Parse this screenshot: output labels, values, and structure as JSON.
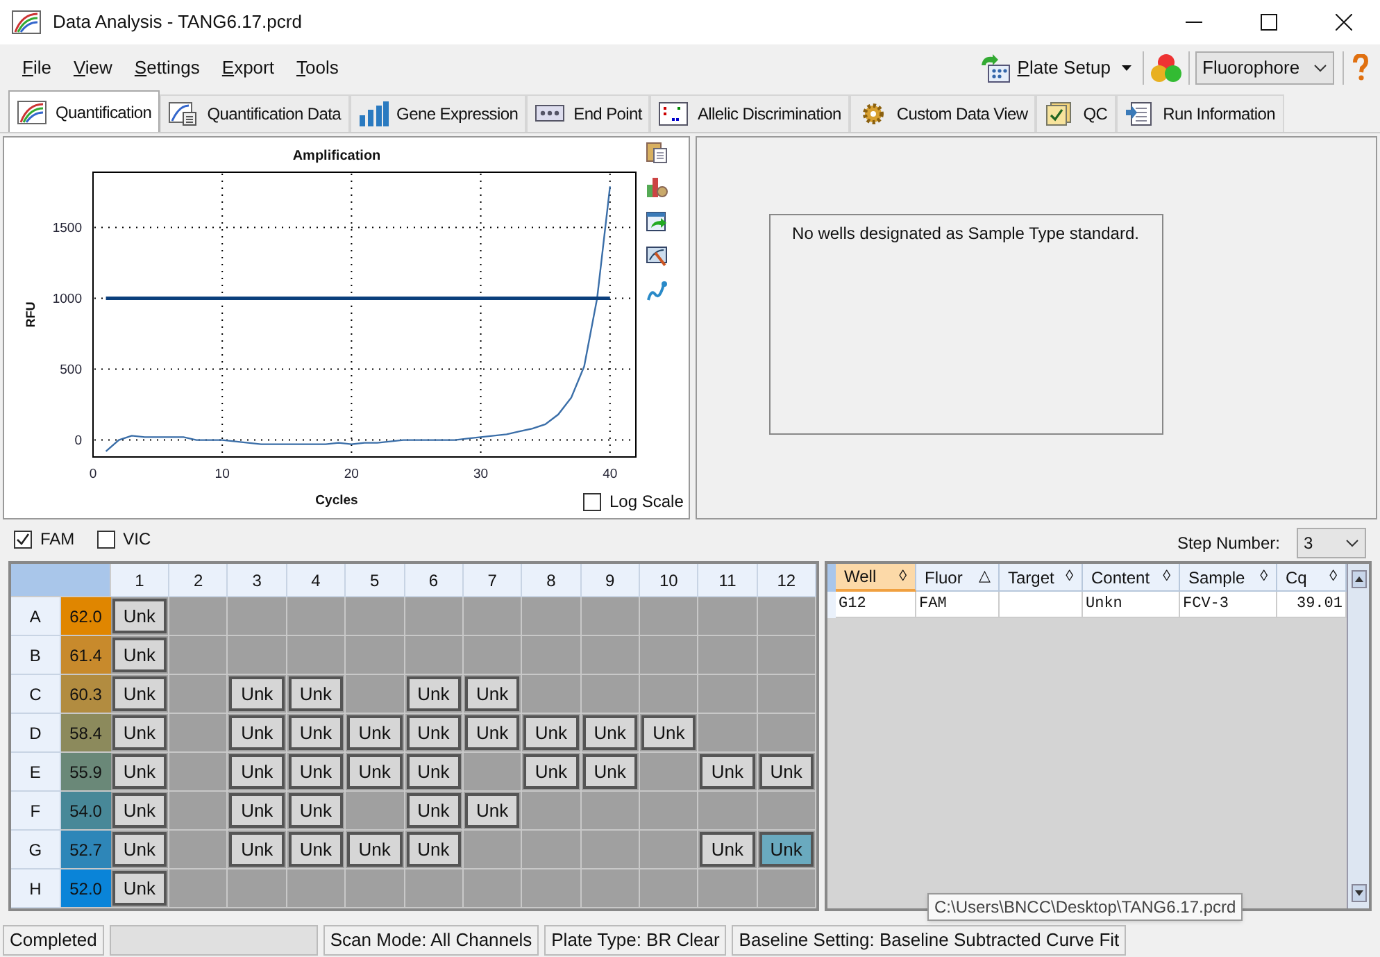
{
  "window": {
    "title": "Data Analysis - TANG6.17.pcrd"
  },
  "menu": [
    "File",
    "View",
    "Settings",
    "Export",
    "Tools"
  ],
  "toolbar": {
    "plate_setup": "Plate Setup",
    "fluorophore": "Fluorophore"
  },
  "tabs": [
    {
      "label": "Quantification",
      "selected": true
    },
    {
      "label": "Quantification Data",
      "selected": false
    },
    {
      "label": "Gene Expression",
      "selected": false
    },
    {
      "label": "End Point",
      "selected": false
    },
    {
      "label": "Allelic Discrimination",
      "selected": false
    },
    {
      "label": "Custom Data View",
      "selected": false
    },
    {
      "label": "QC",
      "selected": false
    },
    {
      "label": "Run Information",
      "selected": false
    }
  ],
  "chart": {
    "chart_data": {
      "type": "line",
      "title": "Amplification",
      "xlabel": "Cycles",
      "ylabel": "RFU",
      "xlim": [
        0,
        42
      ],
      "ylim": [
        -120,
        1890
      ],
      "xticks": [
        0,
        10,
        20,
        30,
        40
      ],
      "yticks": [
        0,
        500,
        1000,
        1500
      ],
      "x": [
        1,
        2,
        3,
        4,
        5,
        6,
        7,
        8,
        9,
        10,
        11,
        12,
        13,
        14,
        15,
        16,
        17,
        18,
        19,
        20,
        21,
        22,
        23,
        24,
        25,
        26,
        27,
        28,
        29,
        30,
        31,
        32,
        33,
        34,
        35,
        36,
        37,
        38,
        39,
        40
      ],
      "grid": true,
      "series": [
        {
          "color": "#3a6ea8",
          "values": [
            -80,
            0,
            30,
            20,
            20,
            20,
            20,
            0,
            0,
            0,
            -10,
            -20,
            -30,
            -30,
            -30,
            -30,
            -30,
            -30,
            -20,
            -30,
            -20,
            -20,
            -10,
            0,
            0,
            0,
            0,
            0,
            10,
            20,
            30,
            40,
            60,
            80,
            110,
            180,
            300,
            520,
            1000,
            1790
          ]
        },
        {
          "color": "#0b3f7c",
          "values": [
            1000,
            1000,
            1000,
            1000,
            1000,
            1000,
            1000,
            1000,
            1000,
            1000,
            1000,
            1000,
            1000,
            1000,
            1000,
            1000,
            1000,
            1000,
            1000,
            1000,
            1000,
            1000,
            1000,
            1000,
            1000,
            1000,
            1000,
            1000,
            1000,
            1000,
            1000,
            1000,
            1000,
            1000,
            1000,
            1000,
            1000,
            1000,
            1000,
            1000
          ]
        }
      ]
    }
  },
  "log_scale": {
    "label": "Log Scale",
    "checked": false
  },
  "standard_curve": {
    "message": "No wells designated as Sample Type standard."
  },
  "fluors": [
    {
      "label": "FAM",
      "checked": true
    },
    {
      "label": "VIC",
      "checked": false
    }
  ],
  "step_number": {
    "label": "Step Number:",
    "value": "3"
  },
  "plate": {
    "columns": [
      "1",
      "2",
      "3",
      "4",
      "5",
      "6",
      "7",
      "8",
      "9",
      "10",
      "11",
      "12"
    ],
    "rows": [
      {
        "label": "A",
        "temperature": "62.0",
        "color": "#e08600",
        "wells": [
          {
            "kind": "sample",
            "content": "Unk",
            "selected": false
          },
          {
            "kind": "empty"
          },
          {
            "kind": "empty"
          },
          {
            "kind": "empty"
          },
          {
            "kind": "empty"
          },
          {
            "kind": "empty"
          },
          {
            "kind": "empty"
          },
          {
            "kind": "empty"
          },
          {
            "kind": "empty"
          },
          {
            "kind": "empty"
          },
          {
            "kind": "empty"
          },
          {
            "kind": "empty"
          }
        ]
      },
      {
        "label": "B",
        "temperature": "61.4",
        "color": "#c88a2c",
        "wells": [
          {
            "kind": "sample",
            "content": "Unk",
            "selected": false
          },
          {
            "kind": "empty"
          },
          {
            "kind": "empty"
          },
          {
            "kind": "empty"
          },
          {
            "kind": "empty"
          },
          {
            "kind": "empty"
          },
          {
            "kind": "empty"
          },
          {
            "kind": "empty"
          },
          {
            "kind": "empty"
          },
          {
            "kind": "empty"
          },
          {
            "kind": "empty"
          },
          {
            "kind": "empty"
          }
        ]
      },
      {
        "label": "C",
        "temperature": "60.3",
        "color": "#b28c40",
        "wells": [
          {
            "kind": "sample",
            "content": "Unk",
            "selected": false
          },
          {
            "kind": "empty"
          },
          {
            "kind": "sample",
            "content": "Unk",
            "selected": false
          },
          {
            "kind": "sample",
            "content": "Unk",
            "selected": false
          },
          {
            "kind": "empty"
          },
          {
            "kind": "sample",
            "content": "Unk",
            "selected": false
          },
          {
            "kind": "sample",
            "content": "Unk",
            "selected": false
          },
          {
            "kind": "empty"
          },
          {
            "kind": "empty"
          },
          {
            "kind": "empty"
          },
          {
            "kind": "empty"
          },
          {
            "kind": "empty"
          }
        ]
      },
      {
        "label": "D",
        "temperature": "58.4",
        "color": "#8c8a5c",
        "wells": [
          {
            "kind": "sample",
            "content": "Unk",
            "selected": false
          },
          {
            "kind": "empty"
          },
          {
            "kind": "sample",
            "content": "Unk",
            "selected": false
          },
          {
            "kind": "sample",
            "content": "Unk",
            "selected": false
          },
          {
            "kind": "sample",
            "content": "Unk",
            "selected": false
          },
          {
            "kind": "sample",
            "content": "Unk",
            "selected": false
          },
          {
            "kind": "sample",
            "content": "Unk",
            "selected": false
          },
          {
            "kind": "sample",
            "content": "Unk",
            "selected": false
          },
          {
            "kind": "sample",
            "content": "Unk",
            "selected": false
          },
          {
            "kind": "sample",
            "content": "Unk",
            "selected": false
          },
          {
            "kind": "empty"
          },
          {
            "kind": "empty"
          }
        ]
      },
      {
        "label": "E",
        "temperature": "55.9",
        "color": "#6a8878",
        "wells": [
          {
            "kind": "sample",
            "content": "Unk",
            "selected": false
          },
          {
            "kind": "empty"
          },
          {
            "kind": "sample",
            "content": "Unk",
            "selected": false
          },
          {
            "kind": "sample",
            "content": "Unk",
            "selected": false
          },
          {
            "kind": "sample",
            "content": "Unk",
            "selected": false
          },
          {
            "kind": "sample",
            "content": "Unk",
            "selected": false
          },
          {
            "kind": "empty"
          },
          {
            "kind": "sample",
            "content": "Unk",
            "selected": false
          },
          {
            "kind": "sample",
            "content": "Unk",
            "selected": false
          },
          {
            "kind": "empty"
          },
          {
            "kind": "sample",
            "content": "Unk",
            "selected": false
          },
          {
            "kind": "sample",
            "content": "Unk",
            "selected": false
          }
        ]
      },
      {
        "label": "F",
        "temperature": "54.0",
        "color": "#488898",
        "wells": [
          {
            "kind": "sample",
            "content": "Unk",
            "selected": false
          },
          {
            "kind": "empty"
          },
          {
            "kind": "sample",
            "content": "Unk",
            "selected": false
          },
          {
            "kind": "sample",
            "content": "Unk",
            "selected": false
          },
          {
            "kind": "empty"
          },
          {
            "kind": "sample",
            "content": "Unk",
            "selected": false
          },
          {
            "kind": "sample",
            "content": "Unk",
            "selected": false
          },
          {
            "kind": "empty"
          },
          {
            "kind": "empty"
          },
          {
            "kind": "empty"
          },
          {
            "kind": "empty"
          },
          {
            "kind": "empty"
          }
        ]
      },
      {
        "label": "G",
        "temperature": "52.7",
        "color": "#2e86b8",
        "wells": [
          {
            "kind": "sample",
            "content": "Unk",
            "selected": false
          },
          {
            "kind": "empty"
          },
          {
            "kind": "sample",
            "content": "Unk",
            "selected": false
          },
          {
            "kind": "sample",
            "content": "Unk",
            "selected": false
          },
          {
            "kind": "sample",
            "content": "Unk",
            "selected": false
          },
          {
            "kind": "sample",
            "content": "Unk",
            "selected": false
          },
          {
            "kind": "empty"
          },
          {
            "kind": "empty"
          },
          {
            "kind": "empty"
          },
          {
            "kind": "empty"
          },
          {
            "kind": "sample",
            "content": "Unk",
            "selected": false
          },
          {
            "kind": "sample",
            "content": "Unk",
            "selected": true
          }
        ]
      },
      {
        "label": "H",
        "temperature": "52.0",
        "color": "#0a84d8",
        "wells": [
          {
            "kind": "sample",
            "content": "Unk",
            "selected": false
          },
          {
            "kind": "empty"
          },
          {
            "kind": "empty"
          },
          {
            "kind": "empty"
          },
          {
            "kind": "empty"
          },
          {
            "kind": "empty"
          },
          {
            "kind": "empty"
          },
          {
            "kind": "empty"
          },
          {
            "kind": "empty"
          },
          {
            "kind": "empty"
          },
          {
            "kind": "empty"
          },
          {
            "kind": "empty"
          }
        ]
      }
    ]
  },
  "wells_table": {
    "columns": [
      {
        "label": "Well",
        "sort_mark": "◊",
        "selected": true
      },
      {
        "label": "Fluor",
        "sort_mark": "△",
        "selected": false
      },
      {
        "label": "Target",
        "sort_mark": "◊",
        "selected": false
      },
      {
        "label": "Content",
        "sort_mark": "◊",
        "selected": false
      },
      {
        "label": "Sample",
        "sort_mark": "◊",
        "selected": false
      },
      {
        "label": "Cq",
        "sort_mark": "◊",
        "selected": false
      }
    ],
    "rows": [
      {
        "cells": [
          "G12",
          "FAM",
          null,
          "Unkn",
          "FCV-3",
          "39.01"
        ]
      }
    ]
  },
  "status_bar": {
    "state": "Completed",
    "scan_mode": "Scan Mode: All Channels",
    "plate_type": "Plate Type: BR Clear",
    "baseline": "Baseline Setting: Baseline Subtracted Curve Fit"
  },
  "tooltip": "C:\\Users\\BNCC\\Desktop\\TANG6.17.pcrd"
}
